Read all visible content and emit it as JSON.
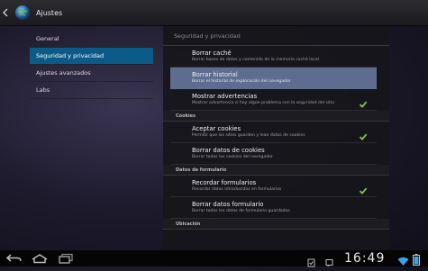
{
  "app_bar": {
    "title": "Ajustes",
    "icons": {
      "back": "back-arrow-icon",
      "app": "settings-globe-icon"
    }
  },
  "left_nav": {
    "items": [
      {
        "label": "General",
        "selected": false
      },
      {
        "label": "Seguridad y privacidad",
        "selected": true
      },
      {
        "label": "Ajustes avanzados",
        "selected": false
      },
      {
        "label": "Labs",
        "selected": false
      }
    ]
  },
  "panel": {
    "title": "Seguridad y privacidad",
    "rows": {
      "borrar_cache": {
        "title": "Borrar caché",
        "summary": "Borrar bases de datos y contenido de la memoria caché local"
      },
      "borrar_historial": {
        "title": "Borrar historial",
        "summary": "Borrar el historial de exploración del navegador"
      },
      "mostrar_advertencias": {
        "title": "Mostrar advertencias",
        "summary": "Mostrar advertencia si hay algún problema con la seguridad del sitio",
        "checked": true
      },
      "aceptar_cookies": {
        "title": "Aceptar cookies",
        "summary": "Permitir que los sitios guarden y lean datos de cookies",
        "checked": true
      },
      "borrar_datos_cookies": {
        "title": "Borrar datos de cookies",
        "summary": "Borrar todas las cookies del navegador"
      },
      "recordar_formularios": {
        "title": "Recordar formularios",
        "summary": "Recordar datos introducidos en formularios",
        "checked": true
      },
      "borrar_datos_formulario": {
        "title": "Borrar datos formulario",
        "summary": "Borrar todos los datos de formulario guardados"
      }
    },
    "sections": {
      "cookies": "Cookies",
      "formulario": "Datos de formulario",
      "ubicacion": "Ubicación"
    }
  },
  "system_bar": {
    "clock": "16:49",
    "icons": [
      "nav-back-icon",
      "nav-home-icon",
      "nav-recent-apps-icon",
      "screenshot-icon",
      "notification-icon",
      "wifi-icon",
      "battery-icon"
    ]
  },
  "colors": {
    "selected_nav": "#0c5a88",
    "highlight_row": "#5e6d8f",
    "check": "#8bc53f"
  }
}
